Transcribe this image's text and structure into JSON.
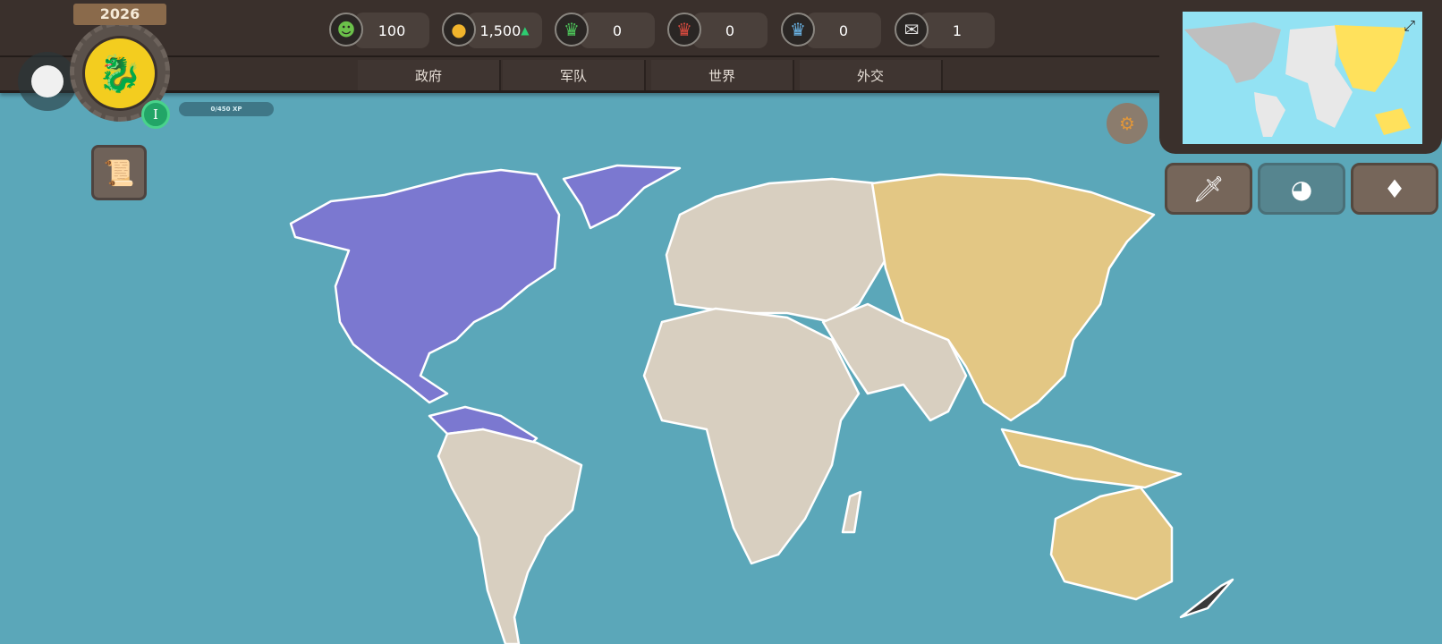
{
  "header": {
    "year": "2026",
    "level": "I",
    "xp": "0/450 XP"
  },
  "resources": [
    {
      "name": "happiness",
      "icon": "smiley-icon",
      "value": "100"
    },
    {
      "name": "money",
      "icon": "gold-coins-icon",
      "value": "1,500"
    },
    {
      "name": "green-crown",
      "icon": "green-crown-icon",
      "value": "0"
    },
    {
      "name": "red-crown",
      "icon": "red-crown-icon",
      "value": "0"
    },
    {
      "name": "blue-crown",
      "icon": "blue-crown-icon",
      "value": "0"
    },
    {
      "name": "diplomacy",
      "icon": "letter-icon",
      "value": "1"
    }
  ],
  "tabs": [
    "政府",
    "军队",
    "世界",
    "外交"
  ],
  "colors": {
    "player": "#e3c784",
    "rival": "#7b78d0",
    "neutral": "#d8cfc0",
    "ocean": "#5ba7b9"
  },
  "buttons": {
    "war": "sword-icon",
    "world": "globe-icon",
    "shop": "diamond-icon"
  }
}
